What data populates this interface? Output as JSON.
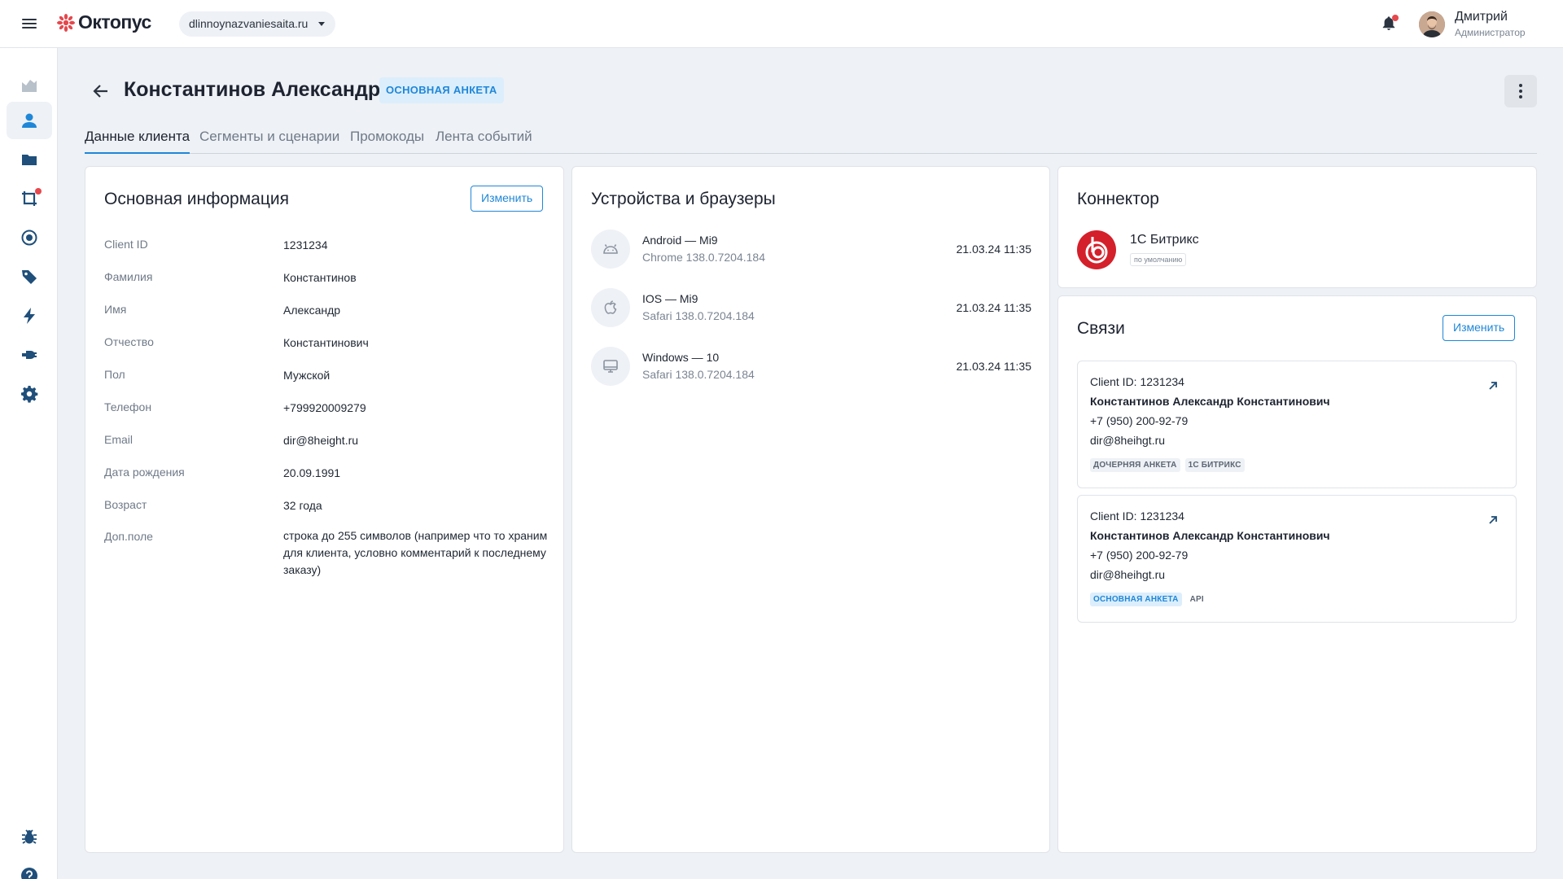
{
  "header": {
    "logo_text": "Октопус",
    "site_select": "dlinnoynazvaniesaita.ru",
    "user_name": "Дмитрий",
    "user_role": "Администратор"
  },
  "sidebar": {
    "items": [
      {
        "icon": "analytics-icon"
      },
      {
        "icon": "person-icon",
        "active": true
      },
      {
        "icon": "folder-icon"
      },
      {
        "icon": "crop-frame-icon",
        "badge": true
      },
      {
        "icon": "target-icon"
      },
      {
        "icon": "tag-icon"
      },
      {
        "icon": "lightning-icon"
      },
      {
        "icon": "plug-icon"
      },
      {
        "icon": "gear-icon"
      },
      {
        "icon": "bug-icon"
      },
      {
        "icon": "help-icon"
      }
    ]
  },
  "page": {
    "title": "Константинов Александр",
    "badge": "ОСНОВНАЯ АНКЕТА"
  },
  "tabs": [
    {
      "label": "Данные клиента",
      "active": true
    },
    {
      "label": "Сегменты и сценарии"
    },
    {
      "label": "Промокоды"
    },
    {
      "label": "Лента событий"
    }
  ],
  "info": {
    "title": "Основная информация",
    "edit_label": "Изменить",
    "rows": [
      {
        "label": "Client ID",
        "value": "1231234"
      },
      {
        "label": "Фамилия",
        "value": "Константинов"
      },
      {
        "label": "Имя",
        "value": "Александр"
      },
      {
        "label": "Отчество",
        "value": "Константинович"
      },
      {
        "label": "Пол",
        "value": "Мужской"
      },
      {
        "label": "Телефон",
        "value": "+799920009279"
      },
      {
        "label": "Email",
        "value": "dir@8height.ru"
      },
      {
        "label": "Дата рождения",
        "value": "20.09.1991"
      },
      {
        "label": "Возраст",
        "value": "32 года"
      },
      {
        "label": "Доп.поле",
        "value": "строка до 255 символов (например что то храним для клиента, условно комментарий к последнему заказу)"
      }
    ]
  },
  "devices": {
    "title": "Устройства и браузеры",
    "items": [
      {
        "name": "Android — Mi9",
        "browser": "Chrome 138.0.7204.184",
        "time": "21.03.24 11:35",
        "icon": "android-icon"
      },
      {
        "name": "IOS — Mi9",
        "browser": "Safari 138.0.7204.184",
        "time": "21.03.24 11:35",
        "icon": "apple-icon"
      },
      {
        "name": "Windows — 10",
        "browser": "Safari 138.0.7204.184",
        "time": "21.03.24 11:35",
        "icon": "desktop-icon"
      }
    ]
  },
  "connector": {
    "title": "Коннектор",
    "name": "1С Битрикс",
    "tag": "по умолчанию"
  },
  "links": {
    "title": "Связи",
    "edit_label": "Изменить",
    "items": [
      {
        "client_id": "Client ID: 1231234",
        "name": "Константинов Александр Константинович",
        "phone": "+7 (950) 200-92-79",
        "email": "dir@8heihgt.ru",
        "tags": [
          {
            "text": "ДОЧЕРНЯЯ АНКЕТА",
            "style": "gray"
          },
          {
            "text": "1С БИТРИКС",
            "style": "gray"
          }
        ]
      },
      {
        "client_id": "Client ID: 1231234",
        "name": "Константинов Александр Константинович",
        "phone": "+7 (950) 200-92-79",
        "email": "dir@8heihgt.ru",
        "tags": [
          {
            "text": "ОСНОВНАЯ АНКЕТА",
            "style": "blue"
          },
          {
            "text": "API",
            "style": "plain"
          }
        ]
      }
    ]
  },
  "colors": {
    "accent": "#1f87d8",
    "brand": "#e5484d",
    "background": "#eef1f5"
  }
}
